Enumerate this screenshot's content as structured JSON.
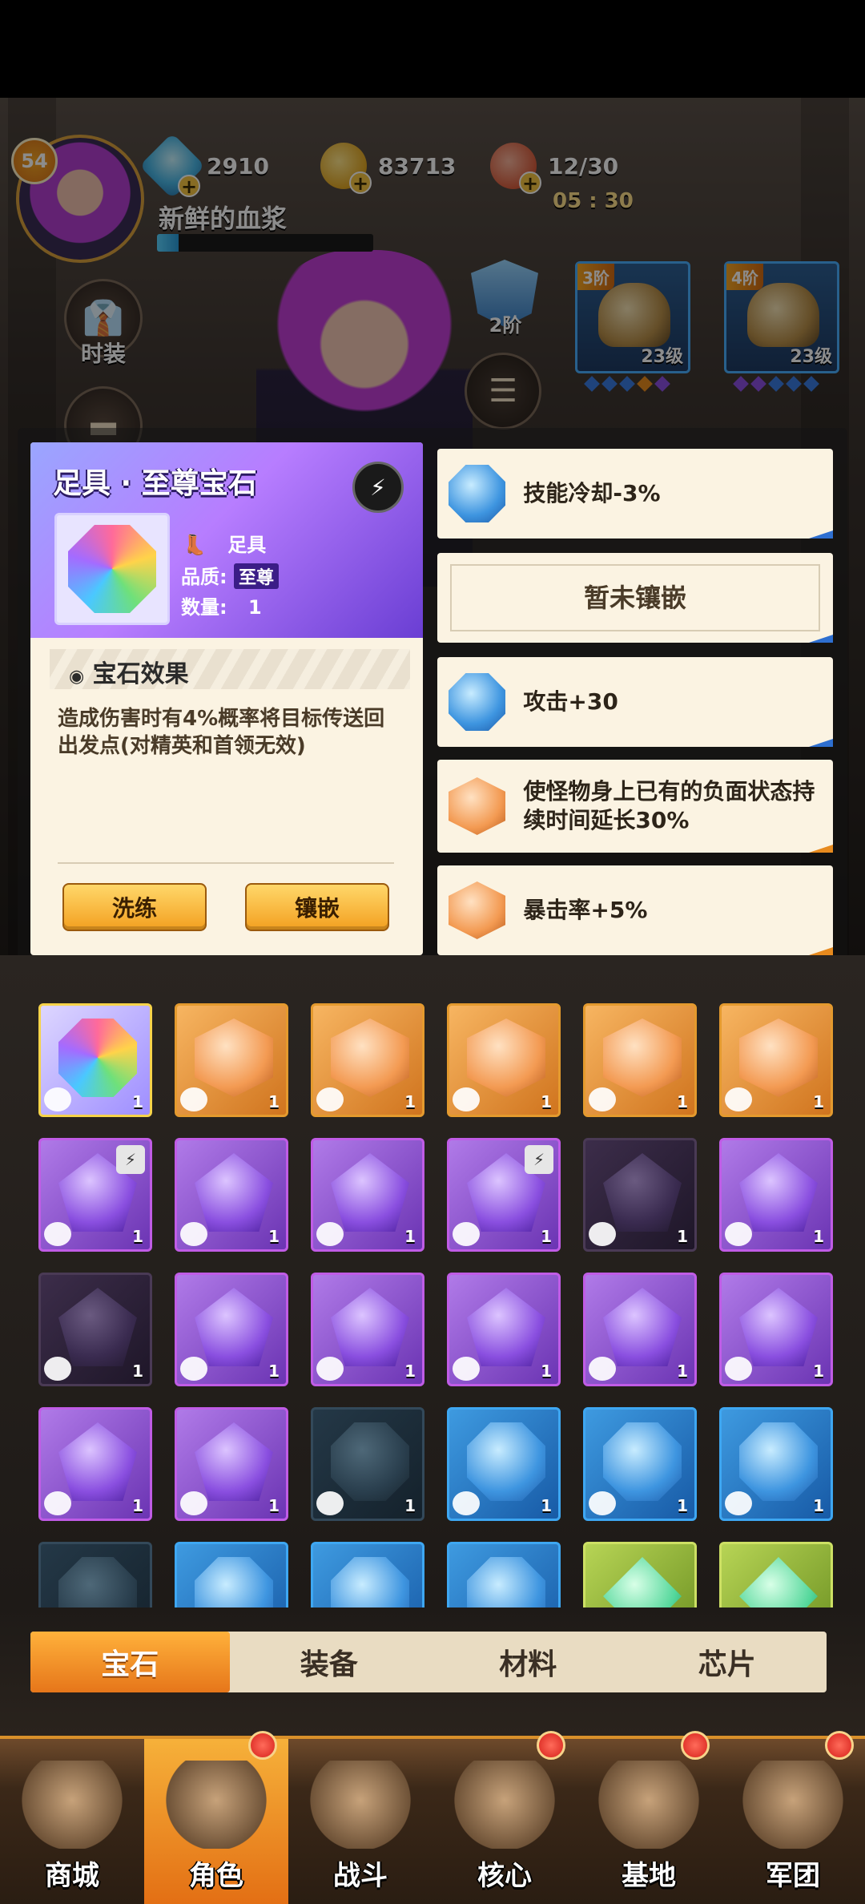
{
  "header": {
    "level": "54",
    "player_name": "新鲜的血浆",
    "exp_fraction": 0.1,
    "resources": {
      "gems": "2910",
      "coins": "83713",
      "stamina": "12/30",
      "timer": "05 : 30"
    }
  },
  "side_menu": {
    "costume_label": "时装"
  },
  "rank": {
    "label": "2阶"
  },
  "gem_menu_label": "宝石",
  "equipment": [
    {
      "tier": "3阶",
      "level": "23级",
      "icon": "helmet-icon"
    },
    {
      "tier": "4阶",
      "level": "23级",
      "icon": "gloves-icon"
    }
  ],
  "gem_detail": {
    "title": "足具 · 至尊宝石",
    "slot_part": "足具",
    "quality_label": "品质:",
    "quality_value": "至尊",
    "count_label": "数量:",
    "count_value": "1",
    "effect_title": "宝石效果",
    "effect_text": "造成伤害时有4%概率将目标传送回出发点(对精英和首领无效)",
    "reroll_button": "洗练",
    "inlay_button": "镶嵌"
  },
  "gem_slots": [
    {
      "type": "blue",
      "text": "技能冷却-3%"
    },
    {
      "type": "empty",
      "text": "暂未镶嵌"
    },
    {
      "type": "blue",
      "text": "攻击+30"
    },
    {
      "type": "orange",
      "text": "使怪物身上已有的负面状态持续时间延长30%"
    },
    {
      "type": "orange",
      "text": "暴击率+5%"
    }
  ],
  "inventory": [
    {
      "tier": "rainbow",
      "count": "1",
      "locked": false
    },
    {
      "tier": "orange",
      "count": "1",
      "locked": false
    },
    {
      "tier": "orange",
      "count": "1",
      "locked": false
    },
    {
      "tier": "orange",
      "count": "1",
      "locked": false
    },
    {
      "tier": "orange",
      "count": "1",
      "locked": false
    },
    {
      "tier": "orange",
      "count": "1",
      "locked": false
    },
    {
      "tier": "purple",
      "count": "1",
      "locked": true
    },
    {
      "tier": "purple",
      "count": "1",
      "locked": false
    },
    {
      "tier": "purple",
      "count": "1",
      "locked": false
    },
    {
      "tier": "purple",
      "count": "1",
      "locked": true
    },
    {
      "tier": "purple-dim",
      "count": "1",
      "locked": false
    },
    {
      "tier": "purple",
      "count": "1",
      "locked": false
    },
    {
      "tier": "purple-dim",
      "count": "1",
      "locked": false
    },
    {
      "tier": "purple",
      "count": "1",
      "locked": false
    },
    {
      "tier": "purple",
      "count": "1",
      "locked": false
    },
    {
      "tier": "purple",
      "count": "1",
      "locked": false
    },
    {
      "tier": "purple",
      "count": "1",
      "locked": false
    },
    {
      "tier": "purple",
      "count": "1",
      "locked": false
    },
    {
      "tier": "purple",
      "count": "1",
      "locked": false
    },
    {
      "tier": "purple",
      "count": "1",
      "locked": false
    },
    {
      "tier": "blue-dim",
      "count": "1",
      "locked": false
    },
    {
      "tier": "blue",
      "count": "1",
      "locked": false
    },
    {
      "tier": "blue",
      "count": "1",
      "locked": false
    },
    {
      "tier": "blue",
      "count": "1",
      "locked": false
    },
    {
      "tier": "blue-dim",
      "count": "",
      "locked": false
    },
    {
      "tier": "blue",
      "count": "",
      "locked": false
    },
    {
      "tier": "blue",
      "count": "",
      "locked": false
    },
    {
      "tier": "blue",
      "count": "",
      "locked": false
    },
    {
      "tier": "green",
      "count": "",
      "locked": false
    },
    {
      "tier": "green",
      "count": "",
      "locked": false
    }
  ],
  "tabs": [
    {
      "label": "宝石",
      "active": true
    },
    {
      "label": "装备",
      "active": false
    },
    {
      "label": "材料",
      "active": false
    },
    {
      "label": "芯片",
      "active": false
    }
  ],
  "bottom_nav": [
    {
      "label": "商城",
      "active": false,
      "badge": false,
      "icon": "shop-icon"
    },
    {
      "label": "角色",
      "active": true,
      "badge": true,
      "icon": "character-icon"
    },
    {
      "label": "战斗",
      "active": false,
      "badge": false,
      "icon": "battle-icon"
    },
    {
      "label": "核心",
      "active": false,
      "badge": true,
      "icon": "core-icon"
    },
    {
      "label": "基地",
      "active": false,
      "badge": true,
      "icon": "base-icon"
    },
    {
      "label": "军团",
      "active": false,
      "badge": true,
      "icon": "legion-icon"
    }
  ],
  "colors": {
    "accent_orange": "#e6761a",
    "legend_purple": "#6a3ed3",
    "panel_cream": "#fbf3e2"
  }
}
